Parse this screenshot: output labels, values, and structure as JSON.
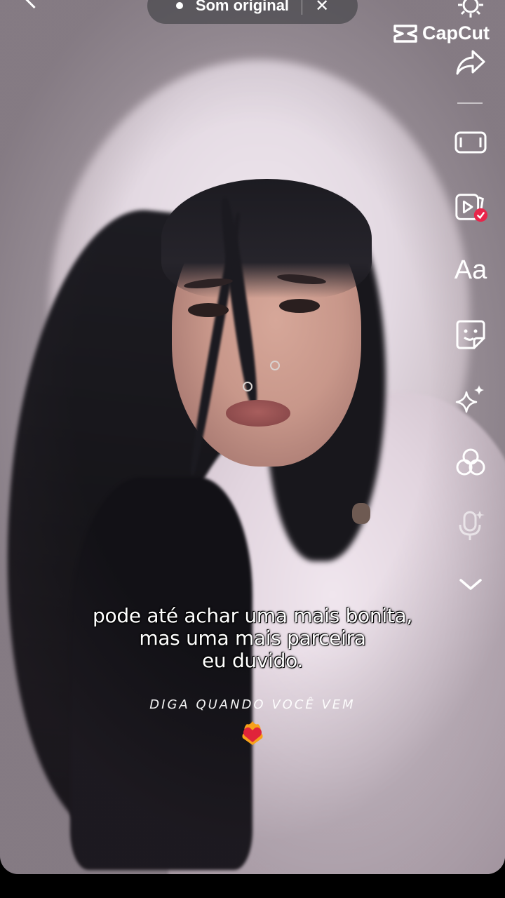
{
  "sound": {
    "label": "Som original"
  },
  "watermark": {
    "brand": "CapCut"
  },
  "toolbar": {
    "text_label": "Aa",
    "items": [
      "settings-icon",
      "share-icon",
      "aspect-ratio-icon",
      "video-template-icon",
      "text-tool",
      "sticker-icon",
      "effects-icon",
      "filters-icon",
      "voice-effect-icon",
      "chevron-down-icon"
    ]
  },
  "caption": {
    "line1": "pode até achar uma mais bonita,",
    "line2": "mas uma mais parceira",
    "line3": "eu duvido."
  },
  "sticker": {
    "text": "DIGA QUANDO VOCÊ VEM"
  },
  "colors": {
    "badge": "#e8254b",
    "text": "#ffffff"
  }
}
